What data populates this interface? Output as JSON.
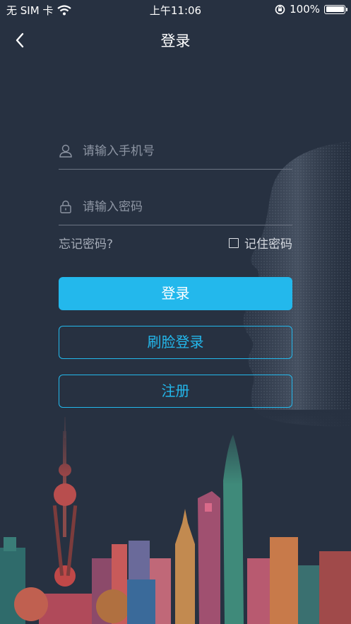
{
  "status_bar": {
    "carrier": "无 SIM 卡",
    "time": "上午11:06",
    "battery": "100%",
    "battery_level": 1.0
  },
  "nav": {
    "title": "登录"
  },
  "form": {
    "phone_placeholder": "请输入手机号",
    "password_placeholder": "请输入密码",
    "forgot_label": "忘记密码?",
    "remember_label": "记住密码"
  },
  "buttons": {
    "login": "登录",
    "face_login": "刷脸登录",
    "register": "注册"
  },
  "colors": {
    "background": "#273141",
    "accent": "#23b8ec"
  }
}
